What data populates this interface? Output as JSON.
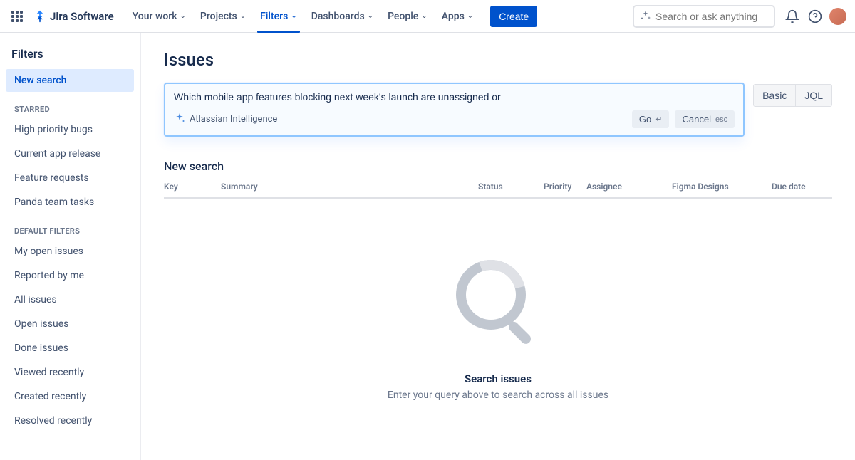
{
  "nav": {
    "logo_text": "Jira Software",
    "items": [
      "Your work",
      "Projects",
      "Filters",
      "Dashboards",
      "People",
      "Apps"
    ],
    "active_index": 2,
    "create_label": "Create",
    "search_placeholder": "Search or ask anything"
  },
  "sidebar": {
    "title": "Filters",
    "new_search": "New search",
    "starred_heading": "STARRED",
    "starred": [
      "High priority bugs",
      "Current app release",
      "Feature requests",
      "Panda team tasks"
    ],
    "default_heading": "DEFAULT FILTERS",
    "defaults": [
      "My open issues",
      "Reported by me",
      "All issues",
      "Open issues",
      "Done issues",
      "Viewed recently",
      "Created recently",
      "Resolved recently"
    ]
  },
  "main": {
    "page_title": "Issues",
    "search_value": "Which mobile app features blocking next week's launch are unassigned or",
    "ai_label": "Atlassian Intelligence",
    "go_label": "Go",
    "go_key": "↵",
    "cancel_label": "Cancel",
    "cancel_key": "esc",
    "basic_label": "Basic",
    "jql_label": "JQL",
    "section_title": "New search",
    "columns": [
      "Key",
      "Summary",
      "Status",
      "Priority",
      "Assignee",
      "Figma Designs",
      "Due date"
    ],
    "empty_title": "Search issues",
    "empty_sub": "Enter your query above to search across all issues"
  }
}
